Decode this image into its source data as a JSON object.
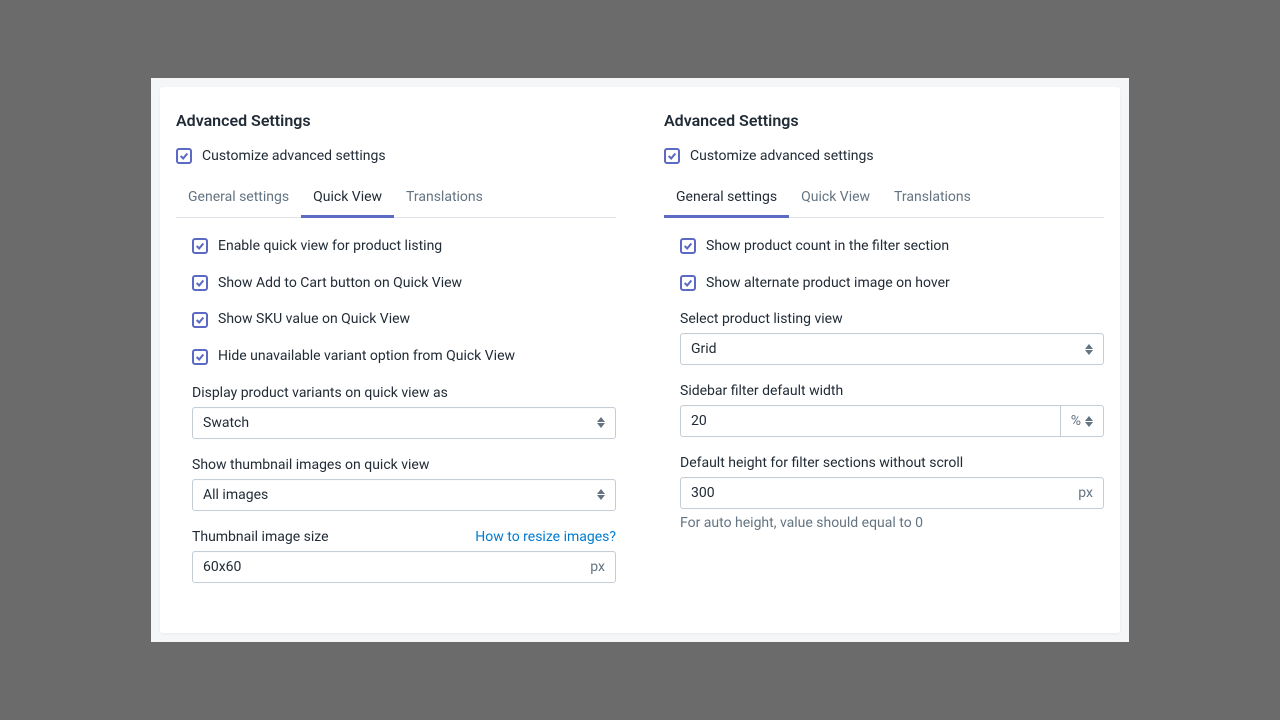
{
  "left": {
    "title": "Advanced Settings",
    "customize_label": "Customize advanced settings",
    "tabs": [
      "General settings",
      "Quick View",
      "Translations"
    ],
    "active_tab": 1,
    "options": [
      "Enable quick view for product listing",
      "Show Add to Cart button on Quick View",
      "Show SKU value on Quick View",
      "Hide unavailable variant option from Quick View"
    ],
    "variant_label": "Display product variants on quick view as",
    "variant_value": "Swatch",
    "thumbnails_label": "Show thumbnail images on quick view",
    "thumbnails_value": "All images",
    "size_label": "Thumbnail image size",
    "size_link": "How to resize images?",
    "size_value": "60x60",
    "size_unit": "px"
  },
  "right": {
    "title": "Advanced Settings",
    "customize_label": "Customize advanced settings",
    "tabs": [
      "General settings",
      "Quick View",
      "Translations"
    ],
    "active_tab": 0,
    "options": [
      "Show product count in the filter section",
      "Show alternate product image on hover"
    ],
    "view_label": "Select product listing view",
    "view_value": "Grid",
    "width_label": "Sidebar filter default width",
    "width_value": "20",
    "width_unit": "%",
    "height_label": "Default height for filter sections without scroll",
    "height_value": "300",
    "height_unit": "px",
    "height_help": "For auto height, value should equal to 0"
  }
}
